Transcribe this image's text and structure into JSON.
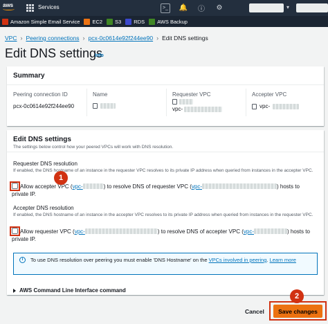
{
  "topnav": {
    "logo_text": "aws",
    "services_label": "Services",
    "icons": [
      "grid-icon",
      "search-icon",
      "terminal-icon",
      "bell-icon",
      "help-icon",
      "settings-icon"
    ]
  },
  "favorites": [
    {
      "label": "Amazon Simple Email Service",
      "icon": "ses-icon",
      "color": "#d13212"
    },
    {
      "label": "EC2",
      "icon": "ec2-icon",
      "color": "#ec7211"
    },
    {
      "label": "S3",
      "icon": "s3-icon",
      "color": "#3f8624"
    },
    {
      "label": "RDS",
      "icon": "rds-icon",
      "color": "#3b48cc"
    },
    {
      "label": "AWS Backup",
      "icon": "backup-icon",
      "color": "#3f8624"
    }
  ],
  "breadcrumb": {
    "items": [
      "VPC",
      "Peering connections",
      "pcx-0c0614e92f244ee90",
      "Edit DNS settings"
    ]
  },
  "page": {
    "title": "Edit DNS settings",
    "info": "Info"
  },
  "summary": {
    "title": "Summary",
    "fields": [
      {
        "label": "Peering connection ID",
        "value": "pcx-0c0614e92f244ee90"
      },
      {
        "label": "Name",
        "value": ""
      },
      {
        "label": "Requester VPC",
        "value": "vpc-"
      },
      {
        "label": "Accepter VPC",
        "value": "vpc-"
      }
    ]
  },
  "dns": {
    "title": "Edit DNS settings",
    "description": "The settings below control how your peered VPCs will work with DNS resolution.",
    "requester": {
      "title": "Requester DNS resolution",
      "description": "If enabled, the DNS hostname of an instance in the requester VPC resolves to its private IP address when queried from instances in the accepter VPC.",
      "checkbox_prefix": "Allow accepter VPC (",
      "vpc1": "vpc-",
      "checkbox_middle": ") to resolve DNS of requester VPC (",
      "vpc2": "vpc-",
      "checkbox_suffix": ") hosts to private IP.",
      "checked": false
    },
    "accepter": {
      "title": "Accepter DNS resolution",
      "description": "If enabled, the DNS hostname of an instance in the accepter VPC resolves to its private IP address when queried from instances in the requester VPC.",
      "checkbox_prefix": "Allow requester VPC (",
      "vpc1": "vpc-",
      "checkbox_middle": ") to resolve DNS of accepter VPC (",
      "vpc2": "vpc-",
      "checkbox_suffix": ") hosts to private IP.",
      "checked": false
    },
    "info_alert": {
      "text_before": "To use DNS resolution over peering you must enable 'DNS Hostname' on the ",
      "link1": "VPCs involved in peering",
      "text_middle": ". ",
      "link2": "Learn more"
    },
    "cli_label": "AWS Command Line Interface command"
  },
  "footer": {
    "cancel_label": "Cancel",
    "save_label": "Save changes"
  },
  "annotations": {
    "step1": "1",
    "step2": "2",
    "color": "#d13212"
  }
}
